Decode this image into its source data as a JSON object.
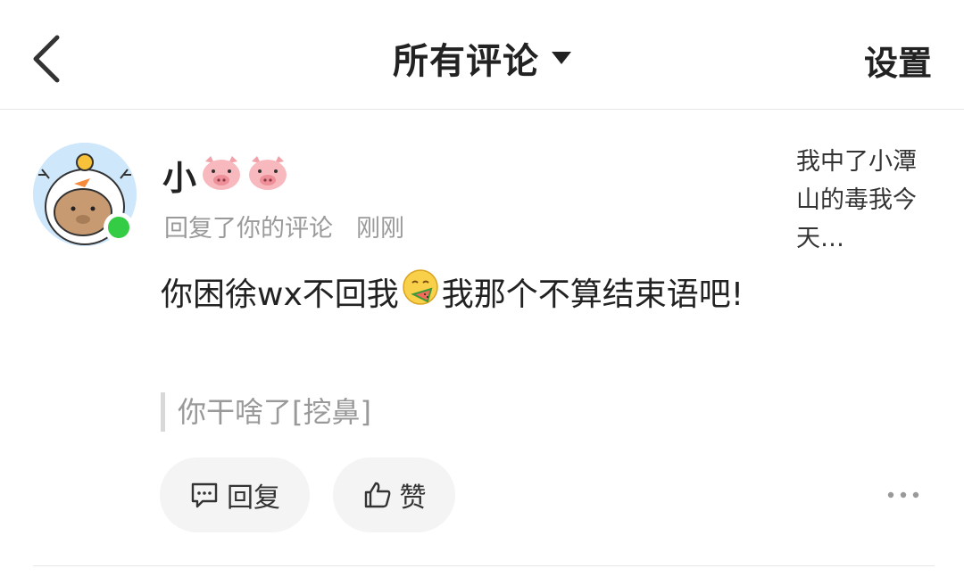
{
  "header": {
    "back_icon": "chevron-left-icon",
    "title": "所有评论",
    "dropdown_icon": "caret-down-icon",
    "settings_label": "设置"
  },
  "comment": {
    "avatar_icon": "capybara-avatar",
    "online_color": "#33cc44",
    "user_name": "小",
    "name_emojis": [
      "pig-face-icon",
      "pig-face-icon"
    ],
    "action_text": "回复了你的评论",
    "time": "刚刚",
    "body_part1": "你困徐wx不回我",
    "body_emoji": "eating-watermelon-emoji",
    "body_part2": "我那个不算结束语吧!",
    "quoted_text": "你干啥了[挖鼻]",
    "reply_label": "回复",
    "like_label": "赞",
    "more_icon": "more-dots-icon",
    "preview_text": "我中了小潭山的毒我今天…"
  },
  "colors": {
    "text": "#222222",
    "muted": "#9a9a9a",
    "button_bg": "#f4f4f4",
    "divider": "#e6e6e6"
  }
}
